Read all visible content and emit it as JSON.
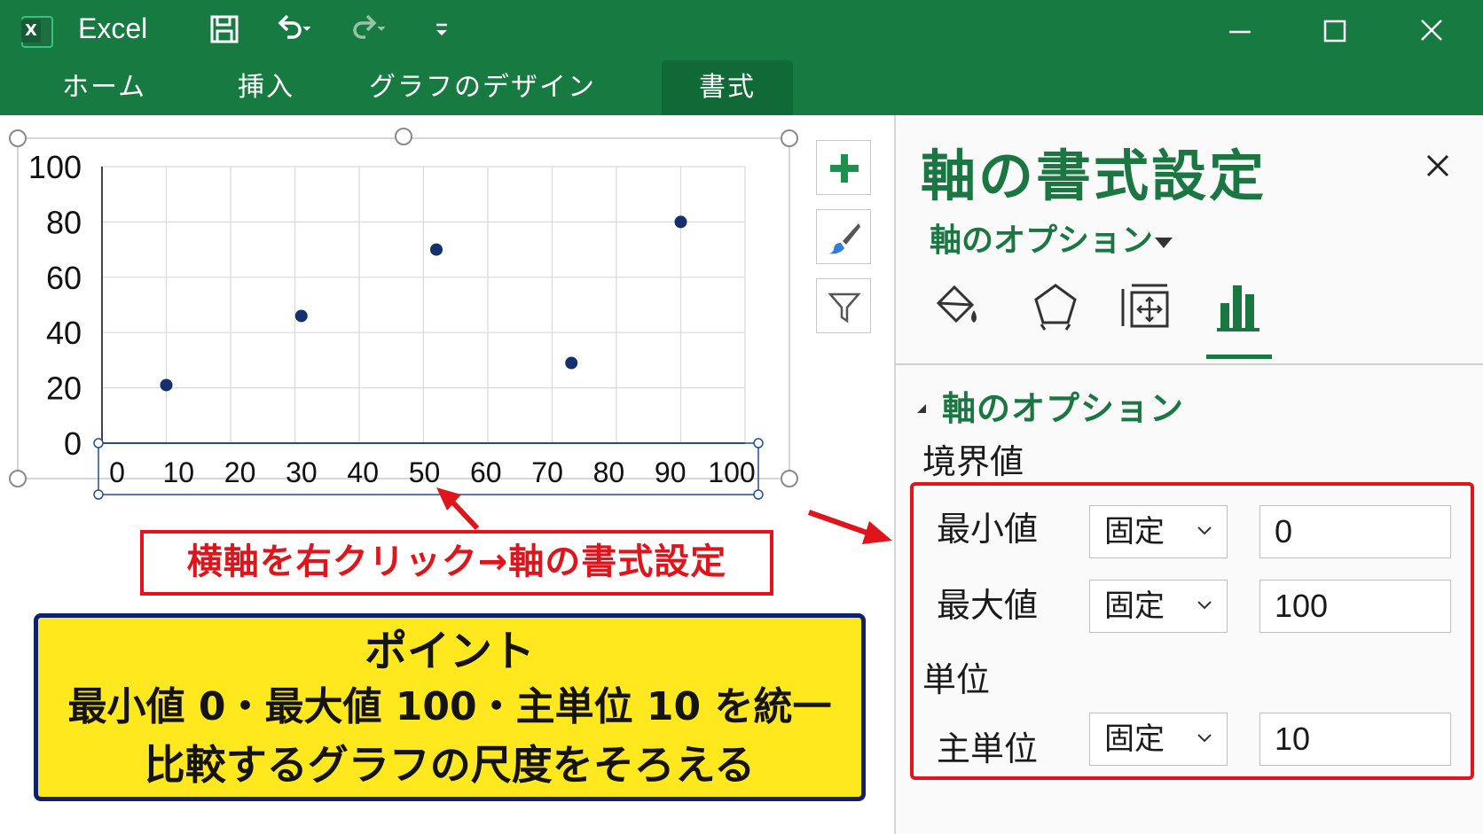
{
  "window": {
    "app_title": "Excel",
    "logo_letter": "X",
    "icons": [
      "save-icon",
      "undo-icon",
      "redo-icon",
      "customize-qat-icon",
      "minimize-icon",
      "maximize-icon",
      "close-icon"
    ]
  },
  "ribbon": {
    "tabs": [
      {
        "label": "ホーム",
        "active": false
      },
      {
        "label": "挿入",
        "active": false
      },
      {
        "label": "グラフのデザイン",
        "active": false
      },
      {
        "label": "書式",
        "active": true
      }
    ]
  },
  "chart_data": {
    "type": "scatter",
    "x": [
      10,
      31,
      52,
      73,
      90
    ],
    "y": [
      21,
      46,
      70,
      29,
      80
    ],
    "xlim": [
      0,
      100
    ],
    "ylim": [
      0,
      100
    ],
    "x_ticks": [
      "0",
      "10",
      "20",
      "30",
      "40",
      "50",
      "60",
      "70",
      "80",
      "90",
      "100"
    ],
    "y_ticks": [
      "0",
      "20",
      "40",
      "60",
      "80",
      "100"
    ],
    "grid": true,
    "marker_color": "#14306e",
    "selected_element": "horizontal-axis"
  },
  "chart_tools": {
    "icons": [
      "plus-icon",
      "brush-icon",
      "filter-icon"
    ]
  },
  "annotations": {
    "callout": "横軸を右クリック→軸の書式設定",
    "point_title": "ポイント",
    "point_line1": "最小値 0・最大値 100・主単位 10 を統一",
    "point_line2": "比較するグラフの尺度をそろえる",
    "callout_color": "#e0141b",
    "point_bg": "#ffe81e"
  },
  "pane": {
    "title": "軸の書式設定",
    "dropdown_label": "軸のオプション",
    "tab_icons": [
      "fill-bucket-icon",
      "pentagon-icon",
      "size-properties-icon",
      "bar-chart-icon"
    ],
    "section_title": "軸のオプション",
    "bounds_label": "境界値",
    "min_label": "最小値",
    "min_mode": "固定",
    "min_value": "0",
    "max_label": "最大値",
    "max_mode": "固定",
    "max_value": "100",
    "units_label": "単位",
    "major_label": "主単位",
    "major_mode": "固定",
    "major_value": "10",
    "accent": "#1a7741"
  }
}
